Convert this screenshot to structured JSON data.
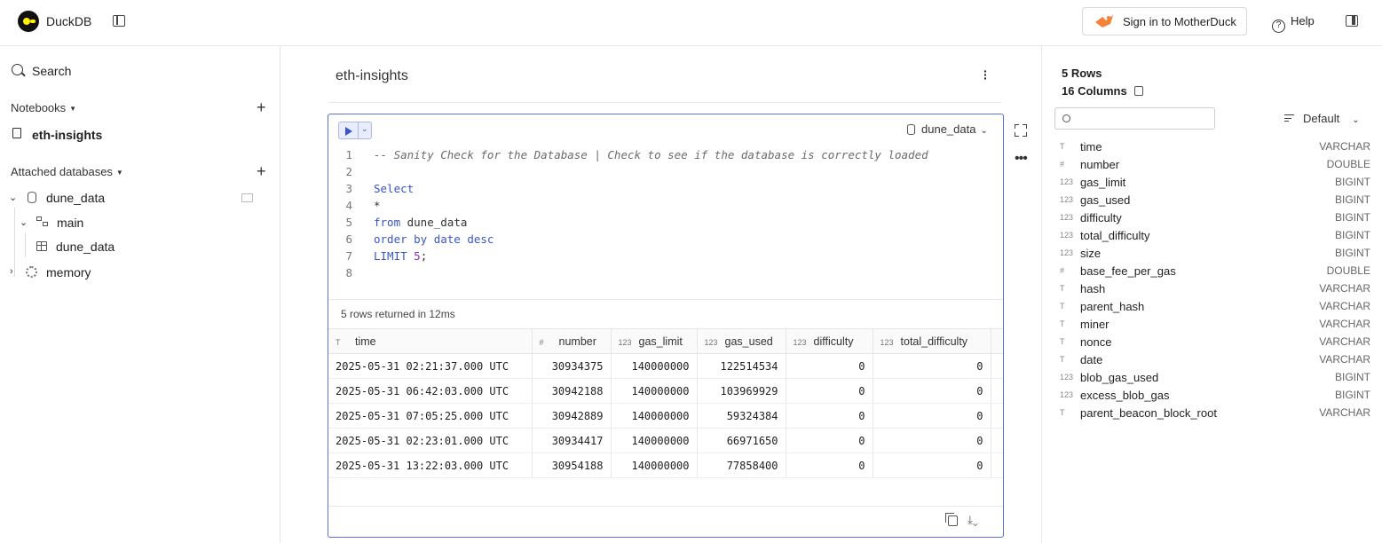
{
  "app": {
    "name": "DuckDB",
    "signin_label": "Sign in to MotherDuck",
    "help_label": "Help",
    "brand_yellow": "#fff100",
    "accent": "#5b72d6"
  },
  "sidebar": {
    "search_label": "Search",
    "notebooks_title": "Notebooks",
    "notebooks": [
      {
        "label": "eth-insights"
      }
    ],
    "attached_title": "Attached databases",
    "tree": {
      "db": "dune_data",
      "schema": "main",
      "table": "dune_data",
      "memory": "memory"
    }
  },
  "notebook": {
    "title": "eth-insights",
    "db_select": "dune_data",
    "code": [
      {
        "n": "1",
        "text": "-- Sanity Check for the Database | Check to see if the database is correctly loaded"
      },
      {
        "n": "2",
        "text": ""
      },
      {
        "n": "3",
        "text": "Select"
      },
      {
        "n": "4",
        "text": "*"
      },
      {
        "n": "5",
        "kw": "from",
        "rest": " dune_data"
      },
      {
        "n": "6",
        "text": "order by date desc"
      },
      {
        "n": "7",
        "kw": "LIMIT",
        "num": "5",
        "tail": ";"
      },
      {
        "n": "8",
        "text": ""
      }
    ],
    "status": "5 rows returned in 12ms",
    "columns": [
      {
        "icon": "T",
        "name": "time"
      },
      {
        "icon": "#",
        "name": "number"
      },
      {
        "icon": "123",
        "name": "gas_limit"
      },
      {
        "icon": "123",
        "name": "gas_used"
      },
      {
        "icon": "123",
        "name": "difficulty"
      },
      {
        "icon": "123",
        "name": "total_difficulty"
      }
    ],
    "rows": [
      [
        "2025-05-31 02:21:37.000 UTC",
        "30934375",
        "140000000",
        "122514534",
        "0",
        "0"
      ],
      [
        "2025-05-31 06:42:03.000 UTC",
        "30942188",
        "140000000",
        "103969929",
        "0",
        "0"
      ],
      [
        "2025-05-31 07:05:25.000 UTC",
        "30942889",
        "140000000",
        "59324384",
        "0",
        "0"
      ],
      [
        "2025-05-31 02:23:01.000 UTC",
        "30934417",
        "140000000",
        "66971650",
        "0",
        "0"
      ],
      [
        "2025-05-31 13:22:03.000 UTC",
        "30954188",
        "140000000",
        "77858400",
        "0",
        "0"
      ]
    ]
  },
  "inspector": {
    "rows_label": "5 Rows",
    "cols_label": "16 Columns",
    "sort_label": "Default",
    "columns": [
      {
        "icon": "T",
        "name": "time",
        "type": "VARCHAR"
      },
      {
        "icon": "#",
        "name": "number",
        "type": "DOUBLE"
      },
      {
        "icon": "123",
        "name": "gas_limit",
        "type": "BIGINT"
      },
      {
        "icon": "123",
        "name": "gas_used",
        "type": "BIGINT"
      },
      {
        "icon": "123",
        "name": "difficulty",
        "type": "BIGINT"
      },
      {
        "icon": "123",
        "name": "total_difficulty",
        "type": "BIGINT"
      },
      {
        "icon": "123",
        "name": "size",
        "type": "BIGINT"
      },
      {
        "icon": "#",
        "name": "base_fee_per_gas",
        "type": "DOUBLE"
      },
      {
        "icon": "T",
        "name": "hash",
        "type": "VARCHAR"
      },
      {
        "icon": "T",
        "name": "parent_hash",
        "type": "VARCHAR"
      },
      {
        "icon": "T",
        "name": "miner",
        "type": "VARCHAR"
      },
      {
        "icon": "T",
        "name": "nonce",
        "type": "VARCHAR"
      },
      {
        "icon": "T",
        "name": "date",
        "type": "VARCHAR"
      },
      {
        "icon": "123",
        "name": "blob_gas_used",
        "type": "BIGINT"
      },
      {
        "icon": "123",
        "name": "excess_blob_gas",
        "type": "BIGINT"
      },
      {
        "icon": "T",
        "name": "parent_beacon_block_root",
        "type": "VARCHAR"
      }
    ]
  }
}
